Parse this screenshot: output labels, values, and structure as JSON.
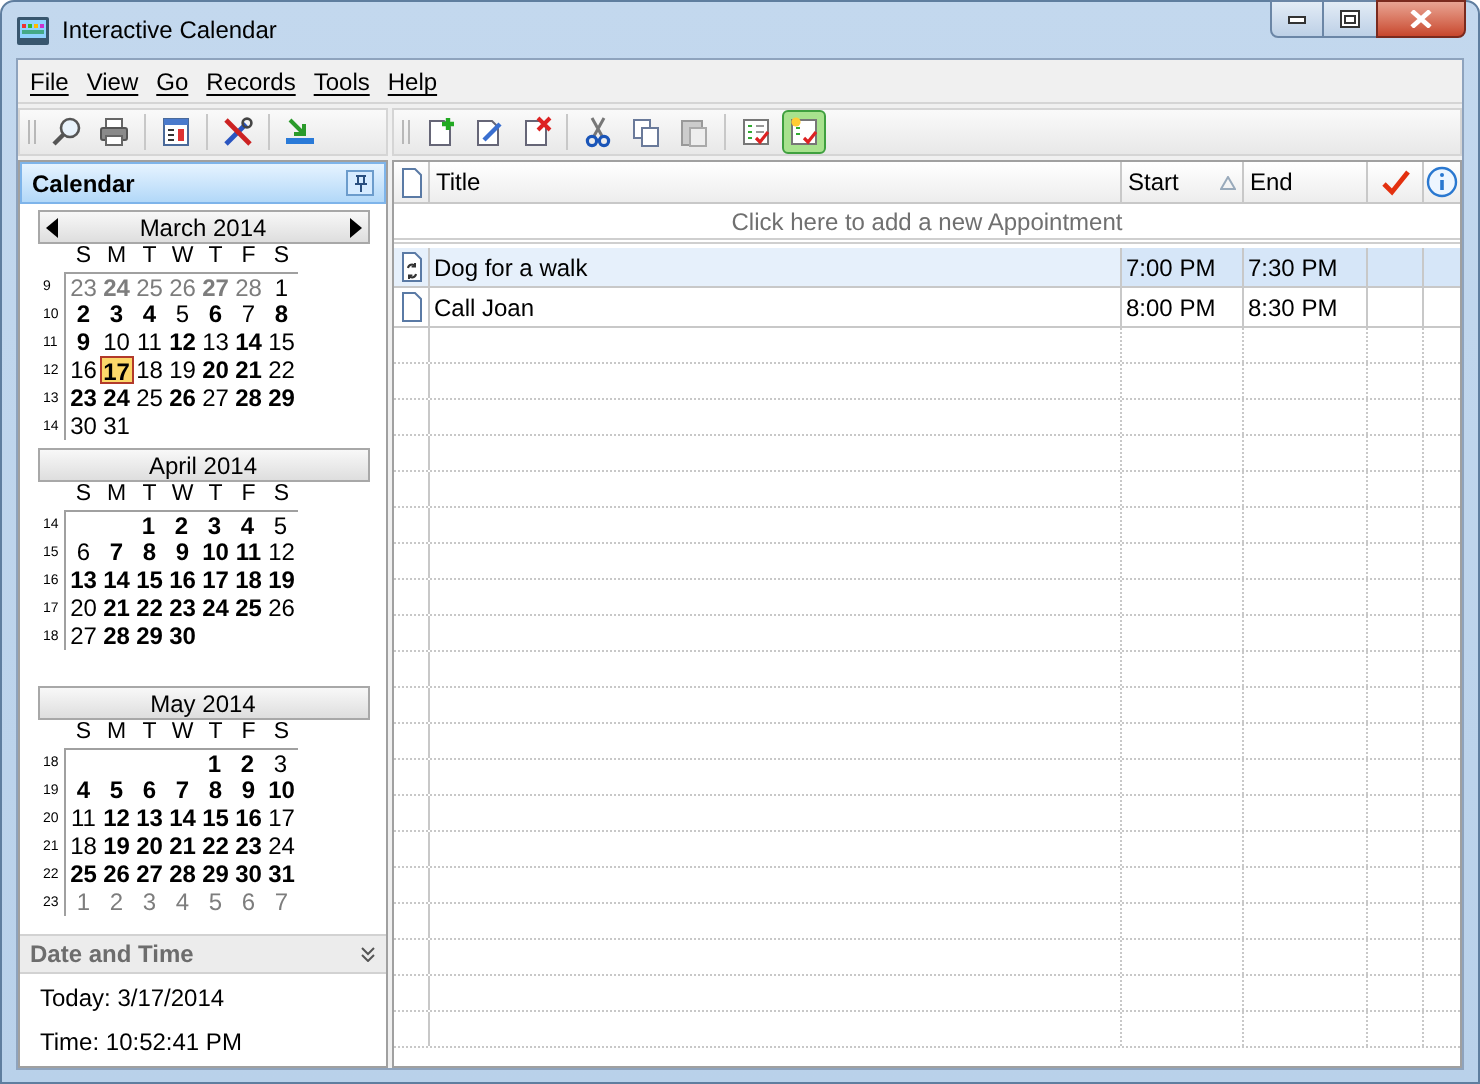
{
  "window": {
    "title": "Interactive Calendar"
  },
  "menu": [
    "File",
    "View",
    "Go",
    "Records",
    "Tools",
    "Help"
  ],
  "left_toolbar": [
    {
      "kind": "search",
      "on": false
    },
    {
      "kind": "print",
      "on": false
    },
    {
      "kind": "calendar",
      "on": false
    },
    {
      "kind": "tools",
      "on": false
    },
    {
      "kind": "import",
      "on": false
    }
  ],
  "right_toolbar": [
    {
      "kind": "new",
      "on": false
    },
    {
      "kind": "edit",
      "on": false
    },
    {
      "kind": "delete",
      "on": false
    },
    {
      "kind": "cut",
      "on": false
    },
    {
      "kind": "copy",
      "on": false
    },
    {
      "kind": "paste",
      "on": false
    },
    {
      "kind": "tasks",
      "on": false
    },
    {
      "kind": "new_task",
      "on": true
    }
  ],
  "calendar_panel": {
    "title": "Calendar",
    "months": [
      {
        "title": "March 2014",
        "arrows": true,
        "weekdays": [
          "S",
          "M",
          "T",
          "W",
          "T",
          "F",
          "S"
        ],
        "weeks": [
          {
            "week": "9",
            "days": [
              {
                "text": "23",
                "bold": false,
                "grey": true,
                "selected": false
              },
              {
                "text": "24",
                "bold": true,
                "grey": true,
                "selected": false
              },
              {
                "text": "25",
                "bold": false,
                "grey": true,
                "selected": false
              },
              {
                "text": "26",
                "bold": false,
                "grey": true,
                "selected": false
              },
              {
                "text": "27",
                "bold": true,
                "grey": true,
                "selected": false
              },
              {
                "text": "28",
                "bold": false,
                "grey": true,
                "selected": false
              },
              {
                "text": "1",
                "bold": false,
                "grey": false,
                "selected": false
              }
            ]
          },
          {
            "week": "10",
            "days": [
              {
                "text": "2",
                "bold": true,
                "grey": false,
                "selected": false
              },
              {
                "text": "3",
                "bold": true,
                "grey": false,
                "selected": false
              },
              {
                "text": "4",
                "bold": true,
                "grey": false,
                "selected": false
              },
              {
                "text": "5",
                "bold": false,
                "grey": false,
                "selected": false
              },
              {
                "text": "6",
                "bold": true,
                "grey": false,
                "selected": false
              },
              {
                "text": "7",
                "bold": false,
                "grey": false,
                "selected": false
              },
              {
                "text": "8",
                "bold": true,
                "grey": false,
                "selected": false
              }
            ]
          },
          {
            "week": "11",
            "days": [
              {
                "text": "9",
                "bold": true,
                "grey": false,
                "selected": false
              },
              {
                "text": "10",
                "bold": false,
                "grey": false,
                "selected": false
              },
              {
                "text": "11",
                "bold": false,
                "grey": false,
                "selected": false
              },
              {
                "text": "12",
                "bold": true,
                "grey": false,
                "selected": false
              },
              {
                "text": "13",
                "bold": false,
                "grey": false,
                "selected": false
              },
              {
                "text": "14",
                "bold": true,
                "grey": false,
                "selected": false
              },
              {
                "text": "15",
                "bold": false,
                "grey": false,
                "selected": false
              }
            ]
          },
          {
            "week": "12",
            "days": [
              {
                "text": "16",
                "bold": false,
                "grey": false,
                "selected": false
              },
              {
                "text": "17",
                "bold": true,
                "grey": false,
                "selected": true
              },
              {
                "text": "18",
                "bold": false,
                "grey": false,
                "selected": false
              },
              {
                "text": "19",
                "bold": false,
                "grey": false,
                "selected": false
              },
              {
                "text": "20",
                "bold": true,
                "grey": false,
                "selected": false
              },
              {
                "text": "21",
                "bold": true,
                "grey": false,
                "selected": false
              },
              {
                "text": "22",
                "bold": false,
                "grey": false,
                "selected": false
              }
            ]
          },
          {
            "week": "13",
            "days": [
              {
                "text": "23",
                "bold": true,
                "grey": false,
                "selected": false
              },
              {
                "text": "24",
                "bold": true,
                "grey": false,
                "selected": false
              },
              {
                "text": "25",
                "bold": false,
                "grey": false,
                "selected": false
              },
              {
                "text": "26",
                "bold": true,
                "grey": false,
                "selected": false
              },
              {
                "text": "27",
                "bold": false,
                "grey": false,
                "selected": false
              },
              {
                "text": "28",
                "bold": true,
                "grey": false,
                "selected": false
              },
              {
                "text": "29",
                "bold": true,
                "grey": false,
                "selected": false
              }
            ]
          },
          {
            "week": "14",
            "days": [
              {
                "text": "30",
                "bold": false,
                "grey": false,
                "selected": false
              },
              {
                "text": "31",
                "bold": false,
                "grey": false,
                "selected": false
              }
            ]
          }
        ]
      },
      {
        "title": "April 2014",
        "arrows": false,
        "weekdays": [
          "S",
          "M",
          "T",
          "W",
          "T",
          "F",
          "S"
        ],
        "weeks": [
          {
            "week": "14",
            "right_aligned": true,
            "days": [
              {
                "text": "1",
                "bold": true,
                "grey": false,
                "selected": false
              },
              {
                "text": "2",
                "bold": true,
                "grey": false,
                "selected": false
              },
              {
                "text": "3",
                "bold": true,
                "grey": false,
                "selected": false
              },
              {
                "text": "4",
                "bold": true,
                "grey": false,
                "selected": false
              },
              {
                "text": "5",
                "bold": false,
                "grey": false,
                "selected": false
              }
            ]
          },
          {
            "week": "15",
            "days": [
              {
                "text": "6",
                "bold": false,
                "grey": false,
                "selected": false
              },
              {
                "text": "7",
                "bold": true,
                "grey": false,
                "selected": false
              },
              {
                "text": "8",
                "bold": true,
                "grey": false,
                "selected": false
              },
              {
                "text": "9",
                "bold": true,
                "grey": false,
                "selected": false
              },
              {
                "text": "10",
                "bold": true,
                "grey": false,
                "selected": false
              },
              {
                "text": "11",
                "bold": true,
                "grey": false,
                "selected": false
              },
              {
                "text": "12",
                "bold": false,
                "grey": false,
                "selected": false
              }
            ]
          },
          {
            "week": "16",
            "days": [
              {
                "text": "13",
                "bold": true,
                "grey": false,
                "selected": false
              },
              {
                "text": "14",
                "bold": true,
                "grey": false,
                "selected": false
              },
              {
                "text": "15",
                "bold": true,
                "grey": false,
                "selected": false
              },
              {
                "text": "16",
                "bold": true,
                "grey": false,
                "selected": false
              },
              {
                "text": "17",
                "bold": true,
                "grey": false,
                "selected": false
              },
              {
                "text": "18",
                "bold": true,
                "grey": false,
                "selected": false
              },
              {
                "text": "19",
                "bold": true,
                "grey": false,
                "selected": false
              }
            ]
          },
          {
            "week": "17",
            "days": [
              {
                "text": "20",
                "bold": false,
                "grey": false,
                "selected": false
              },
              {
                "text": "21",
                "bold": true,
                "grey": false,
                "selected": false
              },
              {
                "text": "22",
                "bold": true,
                "grey": false,
                "selected": false
              },
              {
                "text": "23",
                "bold": true,
                "grey": false,
                "selected": false
              },
              {
                "text": "24",
                "bold": true,
                "grey": false,
                "selected": false
              },
              {
                "text": "25",
                "bold": true,
                "grey": false,
                "selected": false
              },
              {
                "text": "26",
                "bold": false,
                "grey": false,
                "selected": false
              }
            ]
          },
          {
            "week": "18",
            "days": [
              {
                "text": "27",
                "bold": false,
                "grey": false,
                "selected": false
              },
              {
                "text": "28",
                "bold": true,
                "grey": false,
                "selected": false
              },
              {
                "text": "29",
                "bold": true,
                "grey": false,
                "selected": false
              },
              {
                "text": "30",
                "bold": true,
                "grey": false,
                "selected": false
              }
            ]
          }
        ]
      },
      {
        "title": "May 2014",
        "arrows": false,
        "weekdays": [
          "S",
          "M",
          "T",
          "W",
          "T",
          "F",
          "S"
        ],
        "weeks": [
          {
            "week": "18",
            "right_aligned": true,
            "days": [
              {
                "text": "1",
                "bold": true,
                "grey": false,
                "selected": false
              },
              {
                "text": "2",
                "bold": true,
                "grey": false,
                "selected": false
              },
              {
                "text": "3",
                "bold": false,
                "grey": false,
                "selected": false
              }
            ]
          },
          {
            "week": "19",
            "days": [
              {
                "text": "4",
                "bold": true,
                "grey": false,
                "selected": false
              },
              {
                "text": "5",
                "bold": true,
                "grey": false,
                "selected": false
              },
              {
                "text": "6",
                "bold": true,
                "grey": false,
                "selected": false
              },
              {
                "text": "7",
                "bold": true,
                "grey": false,
                "selected": false
              },
              {
                "text": "8",
                "bold": true,
                "grey": false,
                "selected": false
              },
              {
                "text": "9",
                "bold": true,
                "grey": false,
                "selected": false
              },
              {
                "text": "10",
                "bold": true,
                "grey": false,
                "selected": false
              }
            ]
          },
          {
            "week": "20",
            "days": [
              {
                "text": "11",
                "bold": false,
                "grey": false,
                "selected": false
              },
              {
                "text": "12",
                "bold": true,
                "grey": false,
                "selected": false
              },
              {
                "text": "13",
                "bold": true,
                "grey": false,
                "selected": false
              },
              {
                "text": "14",
                "bold": true,
                "grey": false,
                "selected": false
              },
              {
                "text": "15",
                "bold": true,
                "grey": false,
                "selected": false
              },
              {
                "text": "16",
                "bold": true,
                "grey": false,
                "selected": false
              },
              {
                "text": "17",
                "bold": false,
                "grey": false,
                "selected": false
              }
            ]
          },
          {
            "week": "21",
            "days": [
              {
                "text": "18",
                "bold": false,
                "grey": false,
                "selected": false
              },
              {
                "text": "19",
                "bold": true,
                "grey": false,
                "selected": false
              },
              {
                "text": "20",
                "bold": true,
                "grey": false,
                "selected": false
              },
              {
                "text": "21",
                "bold": true,
                "grey": false,
                "selected": false
              },
              {
                "text": "22",
                "bold": true,
                "grey": false,
                "selected": false
              },
              {
                "text": "23",
                "bold": true,
                "grey": false,
                "selected": false
              },
              {
                "text": "24",
                "bold": false,
                "grey": false,
                "selected": false
              }
            ]
          },
          {
            "week": "22",
            "days": [
              {
                "text": "25",
                "bold": true,
                "grey": false,
                "selected": false
              },
              {
                "text": "26",
                "bold": true,
                "grey": false,
                "selected": false
              },
              {
                "text": "27",
                "bold": true,
                "grey": false,
                "selected": false
              },
              {
                "text": "28",
                "bold": true,
                "grey": false,
                "selected": false
              },
              {
                "text": "29",
                "bold": true,
                "grey": false,
                "selected": false
              },
              {
                "text": "30",
                "bold": true,
                "grey": false,
                "selected": false
              },
              {
                "text": "31",
                "bold": true,
                "grey": false,
                "selected": false
              }
            ]
          },
          {
            "week": "23",
            "days": [
              {
                "text": "1",
                "bold": false,
                "grey": true,
                "selected": false
              },
              {
                "text": "2",
                "bold": false,
                "grey": true,
                "selected": false
              },
              {
                "text": "3",
                "bold": false,
                "grey": true,
                "selected": false
              },
              {
                "text": "4",
                "bold": false,
                "grey": true,
                "selected": false
              },
              {
                "text": "5",
                "bold": false,
                "grey": true,
                "selected": false
              },
              {
                "text": "6",
                "bold": false,
                "grey": true,
                "selected": false
              },
              {
                "text": "7",
                "bold": false,
                "grey": true,
                "selected": false
              }
            ]
          }
        ]
      }
    ]
  },
  "date_panel": {
    "title": "Date and Time",
    "today": "Today: 3/17/2014",
    "time": "Time: 10:52:41 PM"
  },
  "table": {
    "columns": [
      {
        "label": "Title",
        "sorted": false
      },
      {
        "label": "Start",
        "sorted": true
      },
      {
        "label": "End",
        "sorted": false
      }
    ],
    "new_row_hint": "Click here to add a new Appointment",
    "rows": [
      {
        "kind": "recurring",
        "selected": true,
        "cells": [
          "Dog for a walk",
          "7:00 PM",
          "7:30 PM"
        ]
      },
      {
        "kind": "single",
        "selected": false,
        "cells": [
          "Call Joan",
          "8:00 PM",
          "8:30 PM"
        ]
      }
    ]
  }
}
